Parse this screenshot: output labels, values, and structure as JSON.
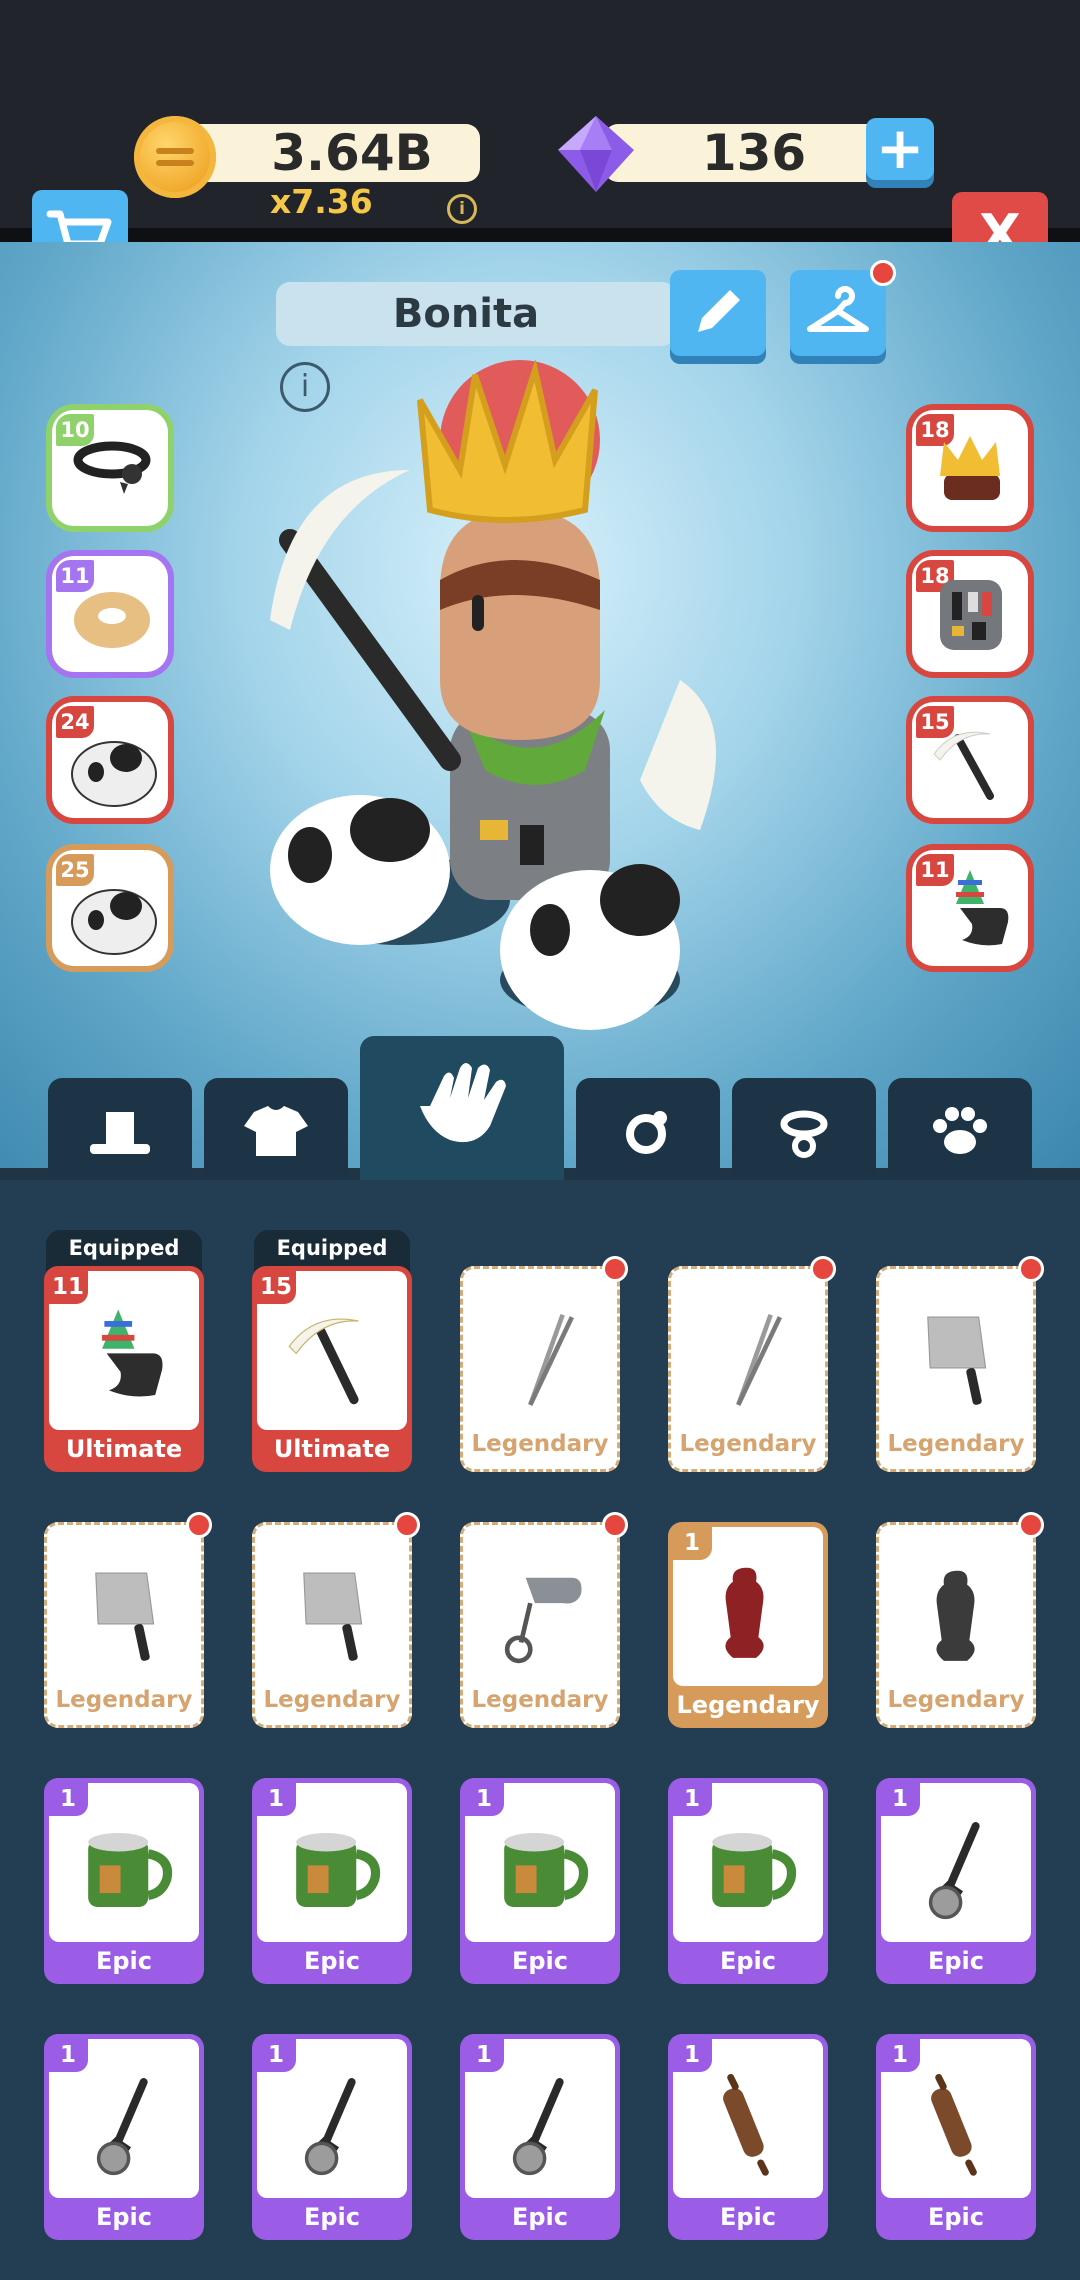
{
  "header": {
    "coins": "3.64B",
    "multiplier": "x7.36",
    "gems": "136",
    "add_label": "+",
    "close_label": "X"
  },
  "character": {
    "name": "Bonita"
  },
  "left_slots": [
    {
      "level": "10",
      "item": "collar"
    },
    {
      "level": "11",
      "item": "donut"
    },
    {
      "level": "24",
      "item": "panda"
    },
    {
      "level": "25",
      "item": "panda"
    }
  ],
  "right_slots": [
    {
      "level": "18",
      "item": "crown"
    },
    {
      "level": "18",
      "item": "robot-outfit"
    },
    {
      "level": "15",
      "item": "pickaxe"
    },
    {
      "level": "11",
      "item": "party-hand"
    }
  ],
  "tabs": [
    {
      "icon": "hat-icon"
    },
    {
      "icon": "shirt-icon"
    },
    {
      "icon": "hand-icon"
    },
    {
      "icon": "ring-icon"
    },
    {
      "icon": "necklace-icon"
    },
    {
      "icon": "paw-icon"
    }
  ],
  "equipped_label": "Equipped",
  "inventory": [
    {
      "rarity": "Ultimate",
      "level": "11",
      "item": "party-hand",
      "equipped": true
    },
    {
      "rarity": "Ultimate",
      "level": "15",
      "item": "pickaxe",
      "equipped": true
    },
    {
      "rarity": "Legendary",
      "item": "tweezers",
      "locked": true
    },
    {
      "rarity": "Legendary",
      "item": "tweezers",
      "locked": true
    },
    {
      "rarity": "Legendary",
      "item": "cleaver",
      "locked": true
    },
    {
      "rarity": "Legendary",
      "item": "cleaver",
      "locked": true
    },
    {
      "rarity": "Legendary",
      "item": "cleaver",
      "locked": true
    },
    {
      "rarity": "Legendary",
      "item": "mixer",
      "locked": true
    },
    {
      "rarity": "Legendary",
      "level": "1",
      "item": "pepper-mill-red"
    },
    {
      "rarity": "Legendary",
      "item": "pepper-mill",
      "locked": true
    },
    {
      "rarity": "Epic",
      "level": "1",
      "item": "mug"
    },
    {
      "rarity": "Epic",
      "level": "1",
      "item": "mug"
    },
    {
      "rarity": "Epic",
      "level": "1",
      "item": "mug"
    },
    {
      "rarity": "Epic",
      "level": "1",
      "item": "mug"
    },
    {
      "rarity": "Epic",
      "level": "1",
      "item": "pizza-cutter"
    },
    {
      "rarity": "Epic",
      "level": "1",
      "item": "pizza-cutter"
    },
    {
      "rarity": "Epic",
      "level": "1",
      "item": "pizza-cutter"
    },
    {
      "rarity": "Epic",
      "level": "1",
      "item": "pizza-cutter"
    },
    {
      "rarity": "Epic",
      "level": "1",
      "item": "rolling-pin"
    },
    {
      "rarity": "Epic",
      "level": "1",
      "item": "rolling-pin"
    }
  ],
  "colors": {
    "ultimate": "#d7463f",
    "legendary": "#d69b5b",
    "epic": "#9b5de5",
    "accent_blue": "#4fb6f2"
  }
}
